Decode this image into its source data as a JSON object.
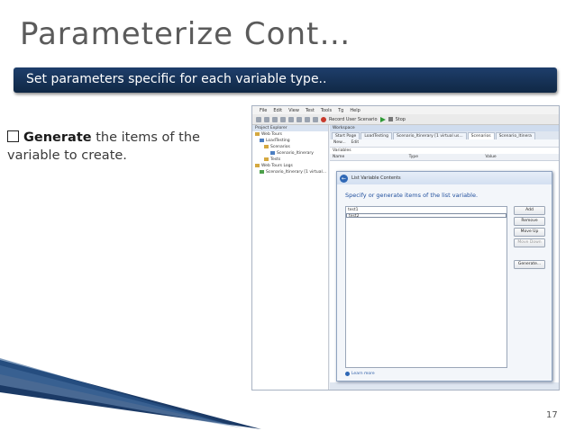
{
  "slide": {
    "title": "Parameterize Cont…",
    "banner": "Set parameters specific for each variable type..",
    "bullet_key": "Generate",
    "bullet_rest": " the items of the",
    "bullet_line2": "variable to create.",
    "page_number": "17"
  },
  "app": {
    "menu": [
      "File",
      "Edit",
      "View",
      "Test",
      "Tools",
      "Tg",
      "Help"
    ],
    "toolbar": {
      "record_label": "Record User Scenario",
      "stop_label": "Stop"
    },
    "explorer": {
      "header": "Project Explorer",
      "items": [
        {
          "label": "Web Tours",
          "icon": "folder-icon"
        },
        {
          "label": "LoadTesting",
          "icon": "folder-icon"
        },
        {
          "label": "Scenarios",
          "icon": "folder-icon"
        },
        {
          "label": "Scenario_Itinerary",
          "icon": "scenario-icon"
        },
        {
          "label": "Tests",
          "icon": "folder-icon"
        },
        {
          "label": "Web Tours Logs",
          "icon": "folder-icon"
        },
        {
          "label": "Scenario_Itinerary [1 virtual...",
          "icon": "log-icon"
        }
      ]
    },
    "workspace": {
      "header": "Workspace",
      "tabs": [
        {
          "label": "Start Page"
        },
        {
          "label": "LoadTesting"
        },
        {
          "label": "Scenario_Itinerary [1 virtual us..."
        },
        {
          "label": "Scenarios",
          "active": true
        },
        {
          "label": "Scenario_Itinera"
        }
      ],
      "new_label": "New...",
      "edit_label": "Edit",
      "variables_label": "Variables",
      "columns": [
        "Name",
        "Type",
        "Value"
      ]
    },
    "dialog": {
      "title": "List Variable Contents",
      "heading": "Specify or generate items of the list variable.",
      "items": [
        "test1",
        "test2"
      ],
      "buttons": {
        "add": "Add",
        "remove": "Remove",
        "move_up": "Move Up",
        "move_down": "Move Down",
        "generate": "Generate..."
      },
      "link": "Learn more"
    }
  }
}
